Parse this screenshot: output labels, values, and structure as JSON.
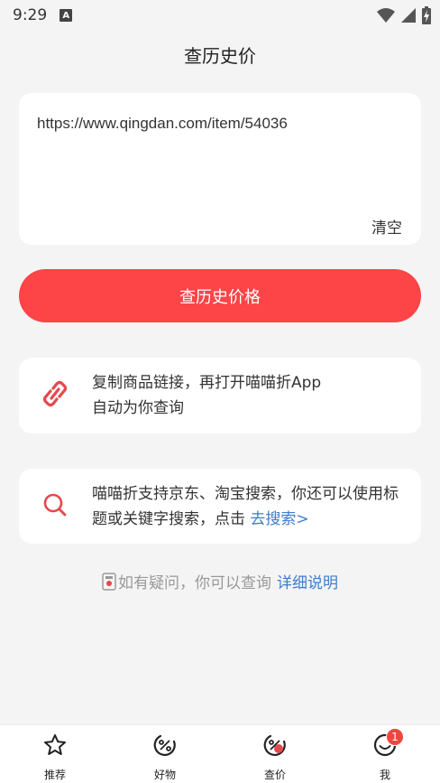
{
  "status": {
    "time": "9:29",
    "a_icon": "A"
  },
  "header": {
    "title": "查历史价"
  },
  "url_input": {
    "value": "https://www.qingdan.com/item/54036",
    "clear_label": "清空"
  },
  "query_button": {
    "label": "查历史价格"
  },
  "tip_copy": {
    "line1": "复制商品链接，再打开喵喵折App",
    "line2": "自动为你查询",
    "icon": "link-icon"
  },
  "tip_search": {
    "text": "喵喵折支持京东、淘宝搜索，你还可以使用标题或关键字搜索，点击",
    "link": "去搜索>",
    "icon": "search-icon"
  },
  "help": {
    "text": "如有疑问，你可以查询",
    "link": "详细说明"
  },
  "tabs": [
    {
      "label": "推荐",
      "icon": "star-icon"
    },
    {
      "label": "好物",
      "icon": "discount-icon"
    },
    {
      "label": "查价",
      "icon": "price-check-icon"
    },
    {
      "label": "我",
      "icon": "smile-icon",
      "badge": "1"
    }
  ],
  "colors": {
    "accent": "#fd4447",
    "link": "#3f7ccd",
    "background": "#f4f4f4"
  }
}
